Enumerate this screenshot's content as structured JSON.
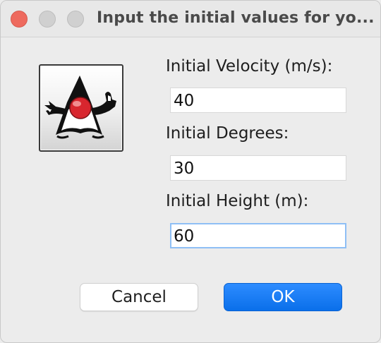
{
  "window": {
    "title": "Input the initial values for yo...",
    "controls": [
      "close",
      "minimize",
      "maximize"
    ]
  },
  "icon": {
    "name": "java-duke-icon"
  },
  "form": {
    "velocity_label": "Initial Velocity (m/s):",
    "velocity_value": "40",
    "degrees_label": "Initial Degrees:",
    "degrees_value": "30",
    "height_label": "Initial Height (m):",
    "height_value": "60"
  },
  "buttons": {
    "cancel_label": "Cancel",
    "ok_label": "OK"
  },
  "colors": {
    "accent": "#0a6fea",
    "close": "#ee6a5e",
    "focus_ring": "#8fbff5"
  }
}
